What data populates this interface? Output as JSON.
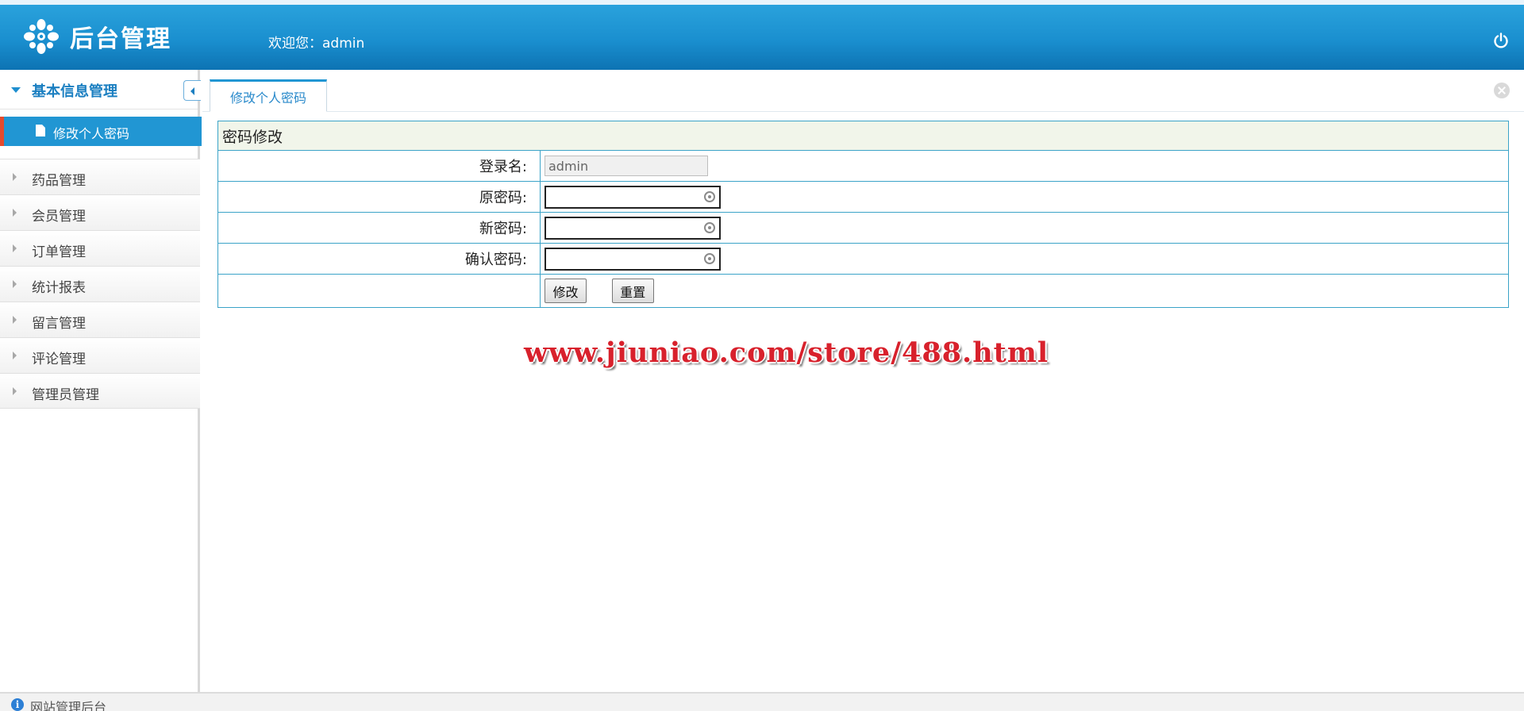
{
  "header": {
    "title": "后台管理",
    "welcome": "欢迎您：admin",
    "logo_icon": "flower-logo-icon",
    "power_icon": "power-icon"
  },
  "sidebar": {
    "group_label": "基本信息管理",
    "active_item": "修改个人密码",
    "items": [
      {
        "label": "药品管理"
      },
      {
        "label": "会员管理"
      },
      {
        "label": "订单管理"
      },
      {
        "label": "统计报表"
      },
      {
        "label": "留言管理"
      },
      {
        "label": "评论管理"
      },
      {
        "label": "管理员管理"
      }
    ]
  },
  "tabs": [
    {
      "label": "修改个人密码",
      "active": true
    }
  ],
  "form": {
    "title": "密码修改",
    "login_label": "登录名:",
    "login_value": "admin",
    "old_label": "原密码:",
    "new_label": "新密码:",
    "confirm_label": "确认密码:",
    "submit_label": "修改",
    "reset_label": "重置"
  },
  "watermark": "www.jiuniao.com/store/488.html",
  "footer": {
    "label": "网站管理后台",
    "icon": "info-icon"
  },
  "colors": {
    "header_blue": "#1a8fcf",
    "active_item": "#2196d3",
    "active_marker": "#e54b2e",
    "table_border": "#3ba3c8",
    "watermark_red": "#d8212c"
  }
}
